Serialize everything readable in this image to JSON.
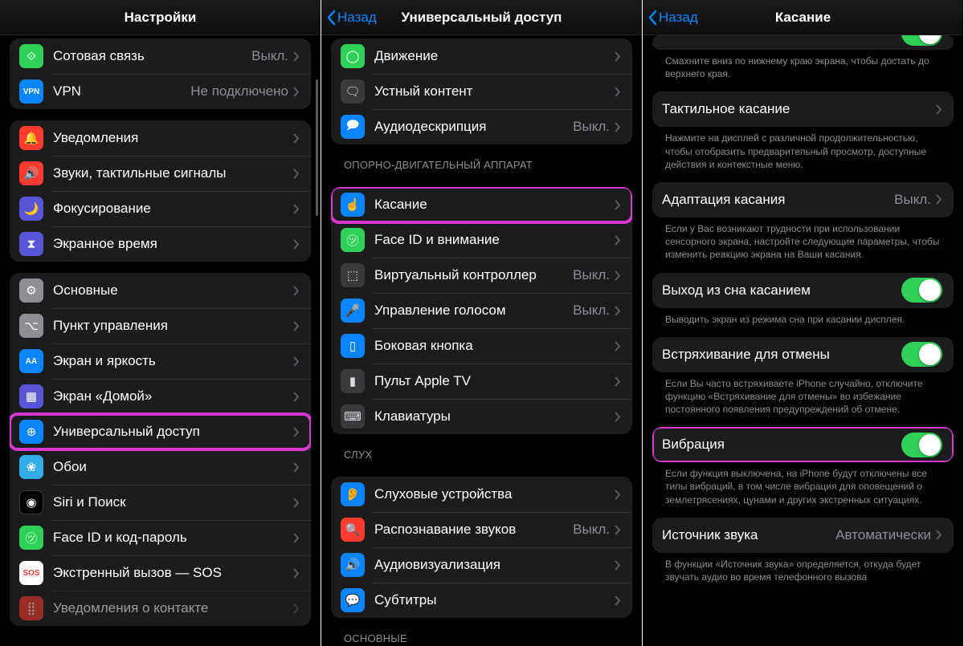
{
  "panel1": {
    "title": "Настройки",
    "groups": [
      {
        "rows": [
          {
            "id": "cellular",
            "label": "Сотовая связь",
            "value": "Выкл.",
            "icon": "antenna-icon",
            "iconGlyph": "⟐",
            "iconBg": "bg-green"
          },
          {
            "id": "vpn",
            "label": "VPN",
            "value": "Не подключено",
            "icon": "vpn-icon",
            "iconGlyph": "VPN",
            "iconBg": "bg-blue",
            "small": true
          }
        ]
      },
      {
        "rows": [
          {
            "id": "notifications",
            "label": "Уведомления",
            "icon": "bell-icon",
            "iconGlyph": "🔔",
            "iconBg": "bg-red"
          },
          {
            "id": "sounds",
            "label": "Звуки, тактильные сигналы",
            "icon": "speaker-icon",
            "iconGlyph": "🔊",
            "iconBg": "bg-red"
          },
          {
            "id": "focus",
            "label": "Фокусирование",
            "icon": "moon-icon",
            "iconGlyph": "🌙",
            "iconBg": "bg-indigo"
          },
          {
            "id": "screentime",
            "label": "Экранное время",
            "icon": "hourglass-icon",
            "iconGlyph": "⧗",
            "iconBg": "bg-indigo"
          }
        ]
      },
      {
        "rows": [
          {
            "id": "general",
            "label": "Основные",
            "icon": "gear-icon",
            "iconGlyph": "⚙",
            "iconBg": "bg-gray"
          },
          {
            "id": "control-center",
            "label": "Пункт управления",
            "icon": "switches-icon",
            "iconGlyph": "⌥",
            "iconBg": "bg-gray"
          },
          {
            "id": "display",
            "label": "Экран и яркость",
            "icon": "text-size-icon",
            "iconGlyph": "AA",
            "iconBg": "bg-blue",
            "small": true
          },
          {
            "id": "homescreen",
            "label": "Экран «Домой»",
            "icon": "grid-icon",
            "iconGlyph": "▦",
            "iconBg": "bg-indigo"
          },
          {
            "id": "accessibility",
            "label": "Универсальный доступ",
            "icon": "accessibility-icon",
            "iconGlyph": "⊕",
            "iconBg": "bg-blue",
            "highlight": true
          },
          {
            "id": "wallpaper",
            "label": "Обои",
            "icon": "flower-icon",
            "iconGlyph": "❀",
            "iconBg": "bg-cyan2"
          },
          {
            "id": "siri",
            "label": "Siri и Поиск",
            "icon": "siri-icon",
            "iconGlyph": "◉",
            "iconBg": "bg-black"
          },
          {
            "id": "faceid",
            "label": "Face ID и код-пароль",
            "icon": "face-icon",
            "iconGlyph": "㋡",
            "iconBg": "bg-green"
          },
          {
            "id": "sos",
            "label": "Экстренный вызов — SOS",
            "icon": "sos-icon",
            "iconGlyph": "SOS",
            "iconBg": "bg-white",
            "small": true
          },
          {
            "id": "exposure",
            "label": "Уведомления о контакте",
            "icon": "exposure-icon",
            "iconGlyph": "⣿",
            "iconBg": "bg-red",
            "fade": true
          }
        ]
      }
    ]
  },
  "panel2": {
    "back": "Назад",
    "title": "Универсальный доступ",
    "groups": [
      {
        "rows": [
          {
            "id": "motion",
            "label": "Движение",
            "icon": "motion-icon",
            "iconGlyph": "◯",
            "iconBg": "bg-green"
          },
          {
            "id": "spoken",
            "label": "Устный контент",
            "icon": "speech-icon",
            "iconGlyph": "🗨",
            "iconBg": "bg-gray2"
          },
          {
            "id": "audiodesc",
            "label": "Аудиодескрипция",
            "value": "Выкл.",
            "icon": "audiodesc-icon",
            "iconGlyph": "🗩",
            "iconBg": "bg-blue"
          }
        ]
      },
      {
        "header": "ОПОРНО-ДВИГАТЕЛЬНЫЙ АППАРАТ",
        "rows": [
          {
            "id": "touch",
            "label": "Касание",
            "icon": "touch-icon",
            "iconGlyph": "☝",
            "iconBg": "bg-blue",
            "highlight": true
          },
          {
            "id": "faceid-attention",
            "label": "Face ID и внимание",
            "icon": "face-icon",
            "iconGlyph": "㋡",
            "iconBg": "bg-green"
          },
          {
            "id": "switch-control",
            "label": "Виртуальный контроллер",
            "value": "Выкл.",
            "icon": "switch-icon",
            "iconGlyph": "⬚",
            "iconBg": "bg-gray2"
          },
          {
            "id": "voice-control",
            "label": "Управление голосом",
            "value": "Выкл.",
            "icon": "voice-icon",
            "iconGlyph": "🎤",
            "iconBg": "bg-blue"
          },
          {
            "id": "side-button",
            "label": "Боковая кнопка",
            "icon": "sidebutton-icon",
            "iconGlyph": "▯",
            "iconBg": "bg-blue"
          },
          {
            "id": "apple-tv-remote",
            "label": "Пульт Apple TV",
            "icon": "remote-icon",
            "iconGlyph": "▮",
            "iconBg": "bg-gray2"
          },
          {
            "id": "keyboards",
            "label": "Клавиатуры",
            "icon": "keyboard-icon",
            "iconGlyph": "⌨",
            "iconBg": "bg-gray2"
          }
        ]
      },
      {
        "header": "СЛУХ",
        "rows": [
          {
            "id": "hearing-devices",
            "label": "Слуховые устройства",
            "icon": "ear-icon",
            "iconGlyph": "👂",
            "iconBg": "bg-blue"
          },
          {
            "id": "sound-recognition",
            "label": "Распознавание звуков",
            "value": "Выкл.",
            "icon": "soundrec-icon",
            "iconGlyph": "🔍",
            "iconBg": "bg-red"
          },
          {
            "id": "audio-visual",
            "label": "Аудиовизуализация",
            "icon": "audiovisual-icon",
            "iconGlyph": "🔊",
            "iconBg": "bg-blue"
          },
          {
            "id": "subtitles",
            "label": "Субтитры",
            "icon": "subtitles-icon",
            "iconGlyph": "💬",
            "iconBg": "bg-blue"
          }
        ]
      },
      {
        "header": "ОСНОВНЫЕ",
        "rows": []
      }
    ]
  },
  "panel3": {
    "back": "Назад",
    "title": "Касание",
    "sections": [
      {
        "type": "toggle-cut",
        "on": true
      },
      {
        "type": "note",
        "text": "Смахните вниз по нижнему краю экрана, чтобы достать до верхнего края."
      },
      {
        "type": "row",
        "id": "haptic-touch",
        "label": "Тактильное касание"
      },
      {
        "type": "note",
        "text": "Нажмите на дисплей с различной продолжительностью, чтобы отобразить предварительный просмотр, доступные действия и контекстные меню."
      },
      {
        "type": "row",
        "id": "touch-accommodations",
        "label": "Адаптация касания",
        "value": "Выкл."
      },
      {
        "type": "note",
        "text": "Если у Вас возникают трудности при использовании сенсорного экрана, настройте следующие параметры, чтобы изменить реакцию экрана на Ваши касания."
      },
      {
        "type": "toggle",
        "id": "tap-to-wake",
        "label": "Выход из сна касанием",
        "on": true
      },
      {
        "type": "note",
        "text": "Выводить экран из режима сна при касании дисплея."
      },
      {
        "type": "toggle",
        "id": "shake-to-undo",
        "label": "Встряхивание для отмены",
        "on": true
      },
      {
        "type": "note",
        "text": "Если Вы часто встряхиваете iPhone случайно, отключите функцию «Встряхивание для отмены» во избежание постоянного появления предупреждений об отмене."
      },
      {
        "type": "toggle",
        "id": "vibration",
        "label": "Вибрация",
        "on": true,
        "highlight": true
      },
      {
        "type": "note",
        "text": "Если функция выключена, на iPhone будут отключены все типы вибраций, в том числе вибрация для оповещений о землетрясениях, цунами и других экстренных ситуациях."
      },
      {
        "type": "row",
        "id": "call-audio-routing",
        "label": "Источник звука",
        "value": "Автоматически"
      },
      {
        "type": "note",
        "text": "В функции «Источник звука» определяется, откуда будет звучать аудио во время телефонного вызова"
      }
    ]
  }
}
